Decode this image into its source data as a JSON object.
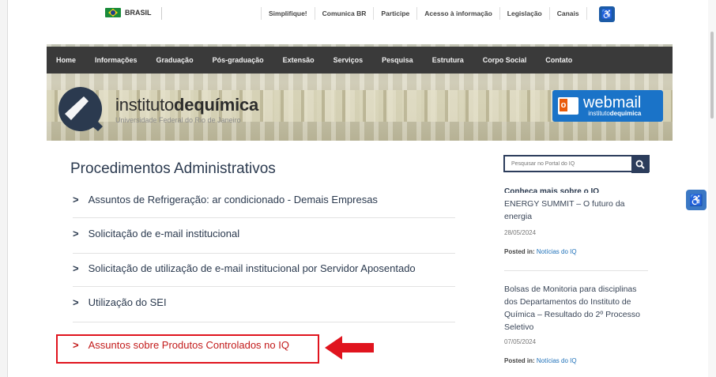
{
  "gov_bar": {
    "country": "BRASIL",
    "links": [
      "Simplifique!",
      "Comunica BR",
      "Participe",
      "Acesso à informação",
      "Legislação",
      "Canais"
    ]
  },
  "nav": {
    "items": [
      "Home",
      "Informações",
      "Graduação",
      "Pós-graduação",
      "Extensão",
      "Serviços",
      "Pesquisa",
      "Estrutura",
      "Corpo Social",
      "Contato"
    ]
  },
  "brand": {
    "name_light": "instituto",
    "name_light2": "de",
    "name_bold": "química",
    "subtitle": "Universidade Federal do Rio de Janeiro"
  },
  "webmail": {
    "label": "webmail",
    "sub_light": "instituto",
    "sub_bold": "dequimica"
  },
  "main": {
    "title": "Procedimentos Administrativos",
    "items": [
      "Assuntos de Refrigeração: ar condicionado - Demais Empresas",
      "Solicitação de e-mail institucional",
      "Solicitação de utilização de e-mail institucional por Servidor Aposentado",
      "Utilização do SEI",
      "Assuntos sobre Produtos Controlados no IQ"
    ]
  },
  "sidebar": {
    "search_placeholder": "Pesquisar no Portal do IQ",
    "section_title": "Conheça mais sobre o IQ",
    "posts": [
      {
        "title": "ENERGY SUMMIT – O futuro da energia",
        "date": "28/05/2024",
        "posted_label": "Posted in:",
        "category": "Notícias do IQ"
      },
      {
        "title": "Bolsas de Monitoria para disciplinas dos Departamentos do Instituto de Química – Resultado do 2º Processo Seletivo",
        "date": "07/05/2024",
        "posted_label": "Posted in:",
        "category": "Notícias do IQ"
      }
    ]
  },
  "colors": {
    "nav_bg": "#3a3a3a",
    "title_blue": "#2b3a4f",
    "highlight_red": "#e0141e",
    "webmail_blue": "#1a73c8"
  }
}
